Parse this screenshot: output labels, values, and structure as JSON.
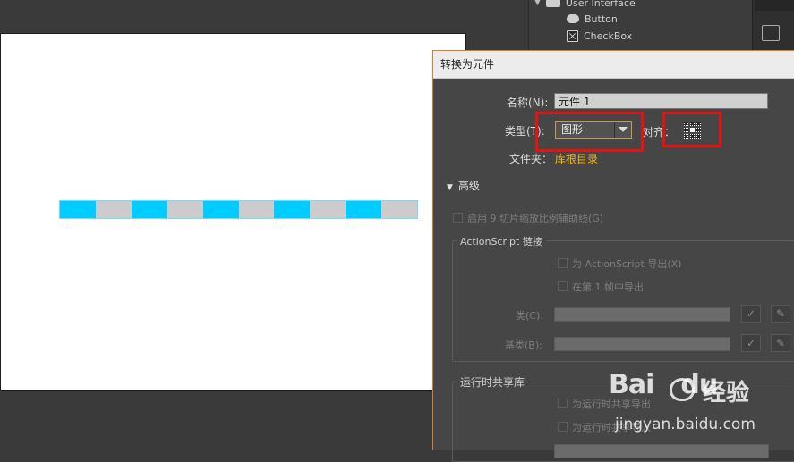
{
  "library": {
    "group_label": "User Interface",
    "items": [
      {
        "label": "Button",
        "icon": "button-symbol-icon"
      },
      {
        "label": "CheckBox",
        "icon": "checkbox-symbol-icon"
      }
    ]
  },
  "dialog": {
    "title": "转换为元件",
    "name_label": "名称(N):",
    "name_value": "元件 1",
    "type_label": "类型(T):",
    "type_value": "图形",
    "align_label": "对齐：",
    "folder_label": "文件夹：",
    "folder_link": "库根目录",
    "advanced_label": "高级",
    "nine_slice_label": "启用 9 切片缩放比例辅助线(G)",
    "actionscript": {
      "legend": "ActionScript 链接",
      "export_label": "为 ActionScript 导出(X)",
      "frame1_label": "在第 1 帧中导出",
      "class_label": "类(C):",
      "base_class_label": "基类(B):"
    },
    "runtime_share": {
      "legend": "运行时共享库",
      "share_export_label": "为运行时共享导出",
      "share_import_label": "为运行时共享导入"
    }
  },
  "watermark": {
    "brand": "Bai",
    "brand_tail": "du",
    "cn": "经验",
    "url": "jingyan.baidu.com"
  },
  "colors": {
    "accent_orange": "#e07b1f",
    "highlight_red": "#e41212",
    "link_gold": "#f0b73a",
    "strip_cyan": "#00ccff",
    "strip_gray": "#cccccc"
  }
}
